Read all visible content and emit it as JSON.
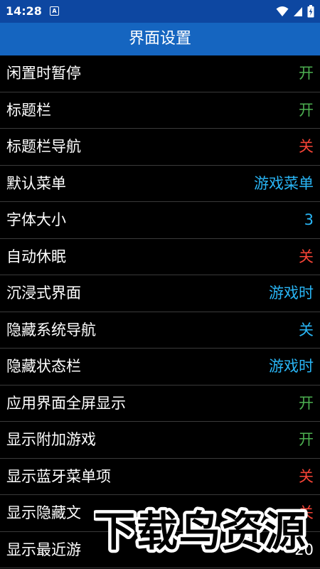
{
  "status_bar": {
    "time": "14:28",
    "notification_icon": "a-badge-icon",
    "icons": [
      "wifi-icon",
      "signal-icon",
      "battery-icon"
    ]
  },
  "header": {
    "title": "界面设置"
  },
  "colors": {
    "status_bar": "#0d47a1",
    "title_bar": "#1565c0",
    "on": "#4caf50",
    "off": "#f44336",
    "info": "#29b6f6",
    "divider": "#3a3a3a",
    "background": "#000000"
  },
  "settings": [
    {
      "label": "闲置时暂停",
      "value": "开",
      "tone": "on"
    },
    {
      "label": "标题栏",
      "value": "开",
      "tone": "on"
    },
    {
      "label": "标题栏导航",
      "value": "关",
      "tone": "off"
    },
    {
      "label": "默认菜单",
      "value": "游戏菜单",
      "tone": "info"
    },
    {
      "label": "字体大小",
      "value": "3",
      "tone": "info"
    },
    {
      "label": "自动休眠",
      "value": "关",
      "tone": "off"
    },
    {
      "label": "沉浸式界面",
      "value": "游戏时",
      "tone": "info"
    },
    {
      "label": "隐藏系统导航",
      "value": "关",
      "tone": "info"
    },
    {
      "label": "隐藏状态栏",
      "value": "游戏时",
      "tone": "info"
    },
    {
      "label": "应用界面全屏显示",
      "value": "开",
      "tone": "on"
    },
    {
      "label": "显示附加游戏",
      "value": "开",
      "tone": "on"
    },
    {
      "label": "显示蓝牙菜单项",
      "value": "关",
      "tone": "off"
    },
    {
      "label": "显示隐藏文",
      "value": "关",
      "tone": "off"
    },
    {
      "label": "显示最近游",
      "value": "20",
      "tone": "plain"
    }
  ],
  "watermark": {
    "text": "下载鸟资源"
  }
}
